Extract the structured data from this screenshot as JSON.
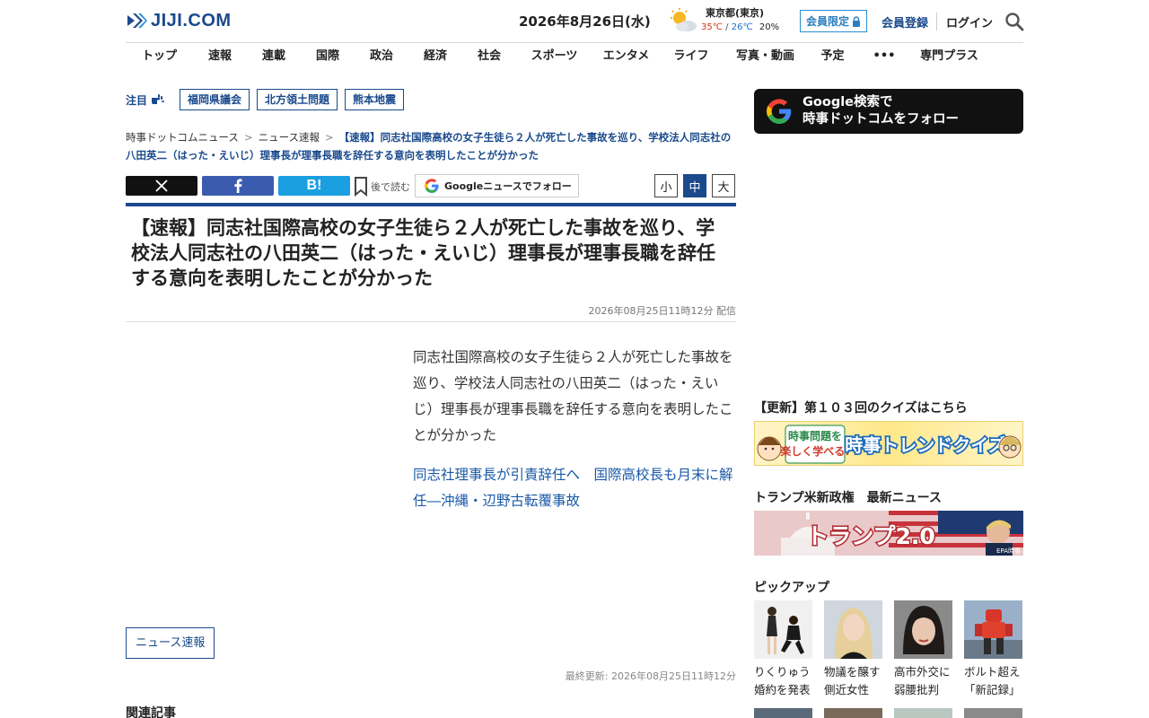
{
  "header": {
    "logo_text": "JIJI.COM",
    "date": "2026年8月26日(水)",
    "weather": {
      "city": "東京都(東京)",
      "high": "35℃",
      "separator": "/",
      "low": "26℃",
      "rain": "20%",
      "icon": "sun-cloud-icon"
    },
    "member_only_label": "会員限定",
    "signup_label": "会員登録",
    "login_label": "ログイン"
  },
  "nav": [
    "トップ",
    "速報",
    "連載",
    "国際",
    "政治",
    "経済",
    "社会",
    "スポーツ",
    "エンタメ",
    "ライフ",
    "写真・動画",
    "予定",
    "•••",
    "専門プラス"
  ],
  "trending": {
    "label": "注目",
    "tags": [
      "福岡県議会",
      "北方領土問題",
      "熊本地震"
    ]
  },
  "breadcrumb": {
    "items": [
      "時事ドットコムニュース",
      "ニュース速報"
    ],
    "separator": ">",
    "current": "【速報】同志社国際高校の女子生徒ら２人が死亡した事故を巡り、学校法人同志社の八田英二（はった・えいじ）理事長が理事長職を辞任する意向を表明したことが分かった"
  },
  "share": {
    "hatena_label": "B!",
    "read_later_label": "後で読む",
    "google_news_label": "Googleニュースでフォロー",
    "font_sizes": [
      "小",
      "中",
      "大"
    ],
    "font_size_selected": "中"
  },
  "article": {
    "headline": "【速報】同志社国際高校の女子生徒ら２人が死亡した事故を巡り、学校法人同志社の八田英二（はった・えいじ）理事長が理事長職を辞任する意向を表明したことが分かった",
    "published": "2026年08月25日11時12分",
    "published_suffix": "配信",
    "lead": "同志社国際高校の女子生徒ら２人が死亡した事故を巡り、学校法人同志社の八田英二（はった・えいじ）理事長が理事長職を辞任する意向を表明したことが分かった",
    "related_link": "同志社理事長が引責辞任へ　国際高校長も月末に解任―沖縄・辺野古転覆事故",
    "category_button": "ニュース速報",
    "updated_label": "最終更新:",
    "updated": "2026年08月25日11時12分",
    "related_heading": "関連記事"
  },
  "sidebar": {
    "google_follow": {
      "line1": "Google検索で",
      "line2": "時事ドットコムをフォロー"
    },
    "quiz_heading": "【更新】第１０３回のクイズはこちら",
    "quiz_banner": {
      "small_line1": "時事問題を",
      "small_line2": "楽しく学べる!",
      "title": "時事トレンドクイズ"
    },
    "trump_heading": "トランプ米新政権　最新ニュース",
    "trump_banner": {
      "title": "トランプ2.0",
      "credit": "EPA時事"
    },
    "pickup_heading": "ピックアップ",
    "pickup": [
      {
        "line1": "りくりゅう",
        "line2": "婚約を発表"
      },
      {
        "line1": "物議を醸す",
        "line2": "側近女性"
      },
      {
        "line1": "高市外交に",
        "line2": "弱腰批判"
      },
      {
        "line1": "ボルト超え",
        "line2": "「新記録」"
      }
    ]
  },
  "colors": {
    "brand_navy": "#1a4a8c",
    "link_blue": "#1a5aa8",
    "temp_high": "#d63a1a",
    "temp_low": "#1a6ed6",
    "member_blue": "#2a8fd1"
  }
}
